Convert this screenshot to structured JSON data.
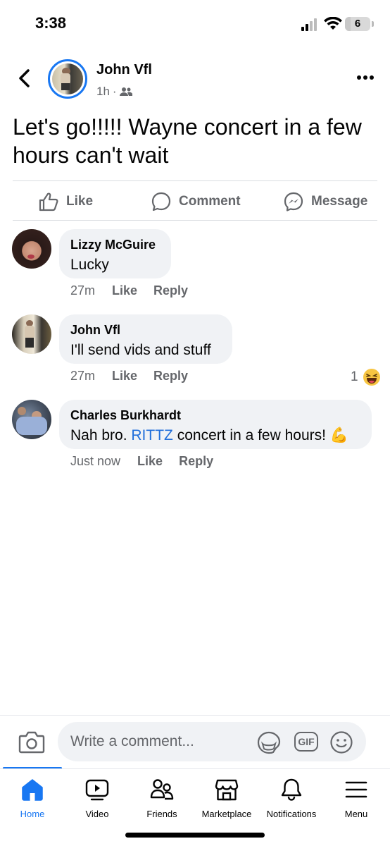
{
  "status_bar": {
    "time": "3:38",
    "battery_level": "6"
  },
  "post": {
    "author": "John Vfl",
    "time": "1h",
    "separator": "·",
    "audience_icon": "friends-icon",
    "text": "Let's go!!!!! Wayne concert in a few hours can't wait"
  },
  "actions": {
    "like": "Like",
    "comment": "Comment",
    "message": "Message"
  },
  "comments": [
    {
      "author": "Lizzy McGuire",
      "text_parts": [
        "Lucky"
      ],
      "time": "27m",
      "like": "Like",
      "reply": "Reply"
    },
    {
      "author": "John Vfl",
      "text_parts": [
        "I'll send vids and stuff"
      ],
      "time": "27m",
      "like": "Like",
      "reply": "Reply",
      "reaction_count": "1",
      "reaction_icon": "haha-emoji-icon"
    },
    {
      "author": "Charles Burkhardt",
      "text_before": "Nah bro. ",
      "mention": "RITTZ",
      "text_after": " concert in a few hours! ",
      "emoji": "💪",
      "time": "Just now",
      "like": "Like",
      "reply": "Reply"
    }
  ],
  "composer": {
    "placeholder": "Write a comment...",
    "gif_label": "GIF"
  },
  "tabs": [
    {
      "label": "Home",
      "icon": "home-icon",
      "active": true
    },
    {
      "label": "Video",
      "icon": "video-icon"
    },
    {
      "label": "Friends",
      "icon": "friends-icon"
    },
    {
      "label": "Marketplace",
      "icon": "marketplace-icon"
    },
    {
      "label": "Notifications",
      "icon": "bell-icon"
    },
    {
      "label": "Menu",
      "icon": "menu-icon"
    }
  ],
  "colors": {
    "accent": "#1877f2",
    "mention": "#216fdb",
    "secondary_text": "#65676b",
    "bubble": "#f0f2f5"
  }
}
